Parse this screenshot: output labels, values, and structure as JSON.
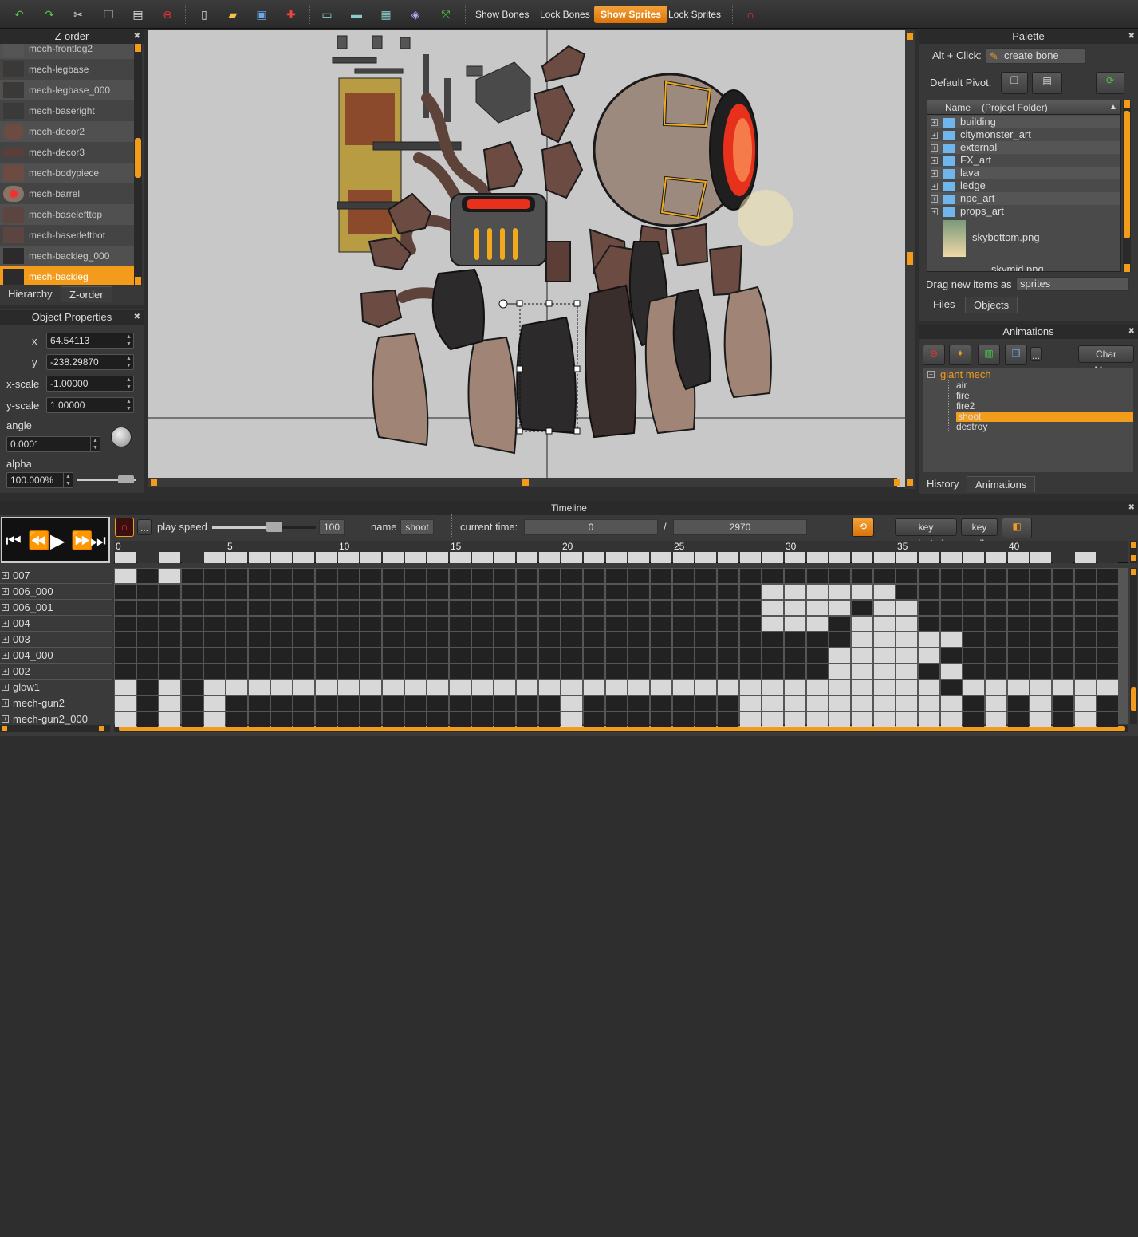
{
  "toolbar": {
    "icons": [
      "undo-icon",
      "redo-icon",
      "cut-icon",
      "copy-icon",
      "paste-icon",
      "delete-icon",
      "new-file-icon",
      "open-folder-icon",
      "save-icon",
      "add-icon",
      "window-icon",
      "window2-icon",
      "window3-icon",
      "color-icon",
      "fit-icon",
      "magnet-icon"
    ],
    "show_bones": "Show Bones",
    "lock_bones": "Lock Bones",
    "show_sprites": "Show Sprites",
    "lock_sprites": "Lock Sprites"
  },
  "zorder": {
    "title": "Z-order",
    "items": [
      "mech-frontleg2",
      "mech-legbase",
      "mech-legbase_000",
      "mech-baseright",
      "mech-decor2",
      "mech-decor3",
      "mech-bodypiece",
      "mech-barrel",
      "mech-baselefttop",
      "mech-baserleftbot",
      "mech-backleg_000",
      "mech-backleg"
    ],
    "selected_index": 11,
    "tabs": [
      "Hierarchy",
      "Z-order"
    ]
  },
  "object_properties": {
    "title": "Object Properties",
    "x_label": "x",
    "x_value": "64.54113",
    "y_label": "y",
    "y_value": "-238.29870",
    "xscale_label": "x-scale",
    "xscale_value": "-1.00000",
    "yscale_label": "y-scale",
    "yscale_value": "1.00000",
    "angle_label": "angle",
    "angle_value": "0.000°",
    "alpha_label": "alpha",
    "alpha_value": "100.000%"
  },
  "palette": {
    "title": "Palette",
    "alt_click_label": "Alt + Click:",
    "create_bone": "create bone",
    "default_pivot_label": "Default Pivot:",
    "col_name": "Name",
    "col_folder": "(Project Folder)",
    "folders": [
      "building",
      "citymonster_art",
      "external",
      "FX_art",
      "lava",
      "ledge",
      "npc_art",
      "props_art"
    ],
    "file_items": [
      "skybottom.png",
      "skymid.png"
    ],
    "drag_label": "Drag new items as",
    "drag_value": "sprites",
    "tabs": [
      "Files",
      "Objects"
    ]
  },
  "animations": {
    "title": "Animations",
    "char_maps": "Char Maps",
    "more": "...",
    "root": "giant mech",
    "items": [
      "air",
      "fire",
      "fire2",
      "shoot",
      "destroy"
    ],
    "selected": "shoot",
    "tabs": [
      "History",
      "Animations"
    ]
  },
  "timeline": {
    "title": "Timeline",
    "more": "...",
    "play_speed_label": "play speed",
    "play_speed_value": "100",
    "play_speed_level": 0.6,
    "name_label": "name",
    "name_value": "shoot",
    "current_time_label": "current time:",
    "current_time_value": "0",
    "separator": "/",
    "total_time": "2970",
    "key_selected": "key selected",
    "key_all": "key all",
    "ruler": [
      "0",
      "5",
      "10",
      "15",
      "20",
      "25",
      "30",
      "35",
      "40"
    ],
    "rows": [
      "007",
      "006_000",
      "006_001",
      "004",
      "003",
      "004_000",
      "002",
      "glow1",
      "mech-gun2",
      "mech-gun2_000"
    ]
  },
  "colors": {
    "accent": "#f39c1c",
    "canvas_bg": "#c8c8c8",
    "panel_bg": "#3a3a3a"
  }
}
